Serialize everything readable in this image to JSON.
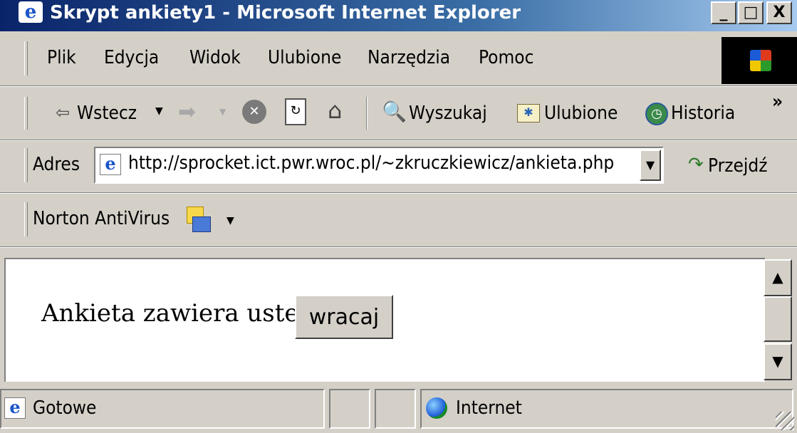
{
  "window": {
    "title": "Skrypt ankiety1 - Microsoft Internet Explorer",
    "controls": {
      "minimize": "_",
      "maximize": "□",
      "close": "X"
    }
  },
  "menu": [
    "Plik",
    "Edycja",
    "Widok",
    "Ulubione",
    "Narzędzia",
    "Pomoc"
  ],
  "toolbar": {
    "back": "Wstecz",
    "search": "Wyszukaj",
    "favorites": "Ulubione",
    "history": "Historia",
    "more": "»"
  },
  "address": {
    "label": "Adres",
    "url": "http://sprocket.ict.pwr.wroc.pl/~zkruczkiewicz/ankieta.php",
    "go": "Przejdź"
  },
  "norton": {
    "label": "Norton AntiVirus"
  },
  "page": {
    "message": "Ankieta zawiera usterki",
    "button": "wracaj"
  },
  "status": {
    "text": "Gotowe",
    "zone": "Internet"
  },
  "colors": {
    "titlebar": "#0a246a",
    "chrome": "#d4d0c8",
    "content": "#ffffff"
  }
}
